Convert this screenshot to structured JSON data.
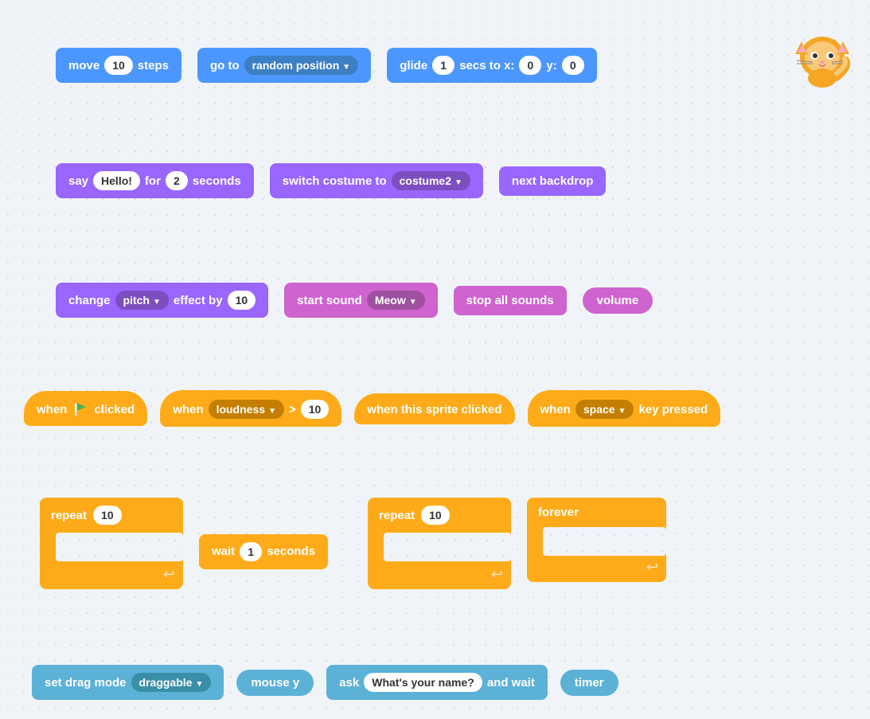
{
  "blocks": {
    "row1": {
      "move": {
        "label": "move",
        "value": "10",
        "suffix": "steps"
      },
      "goto": {
        "label": "go to",
        "dropdown": "random position"
      },
      "glide": {
        "label": "glide",
        "value1": "1",
        "mid": "secs to x:",
        "value2": "0",
        "ysep": "y:",
        "value3": "0"
      }
    },
    "row2": {
      "say": {
        "label": "say",
        "value": "Hello!",
        "mid": "for",
        "value2": "2",
        "suffix": "seconds"
      },
      "switchCostume": {
        "label": "switch costume to",
        "dropdown": "costume2"
      },
      "nextBackdrop": {
        "label": "next backdrop"
      }
    },
    "row3": {
      "changeEffect": {
        "label": "change",
        "dropdown": "pitch",
        "mid": "effect by",
        "value": "10"
      },
      "startSound": {
        "label": "start sound",
        "dropdown": "Meow"
      },
      "stopAllSounds": {
        "label": "stop all sounds"
      },
      "volume": {
        "label": "volume"
      }
    },
    "row4": {
      "whenFlagClicked": {
        "label": "when",
        "flagAlt": "🏴",
        "suffix": "clicked"
      },
      "whenLoudness": {
        "label": "when",
        "dropdown": "loudness",
        "op": ">",
        "value": "10"
      },
      "whenSpriteClicked": {
        "label": "when this sprite clicked"
      },
      "whenKeyPressed": {
        "label": "when",
        "dropdown": "space",
        "suffix": "key pressed"
      }
    },
    "row5": {
      "repeat1": {
        "label": "repeat",
        "value": "10"
      },
      "wait": {
        "label": "wait",
        "value": "1",
        "suffix": "seconds"
      },
      "repeat2": {
        "label": "repeat",
        "value": "10"
      },
      "forever": {
        "label": "forever"
      }
    },
    "row6": {
      "setDragMode": {
        "label": "set drag mode",
        "dropdown": "draggable"
      },
      "mouseY": {
        "label": "mouse y"
      },
      "ask": {
        "label": "ask",
        "value": "What's your name?",
        "suffix": "and wait"
      },
      "timer": {
        "label": "timer"
      }
    }
  }
}
